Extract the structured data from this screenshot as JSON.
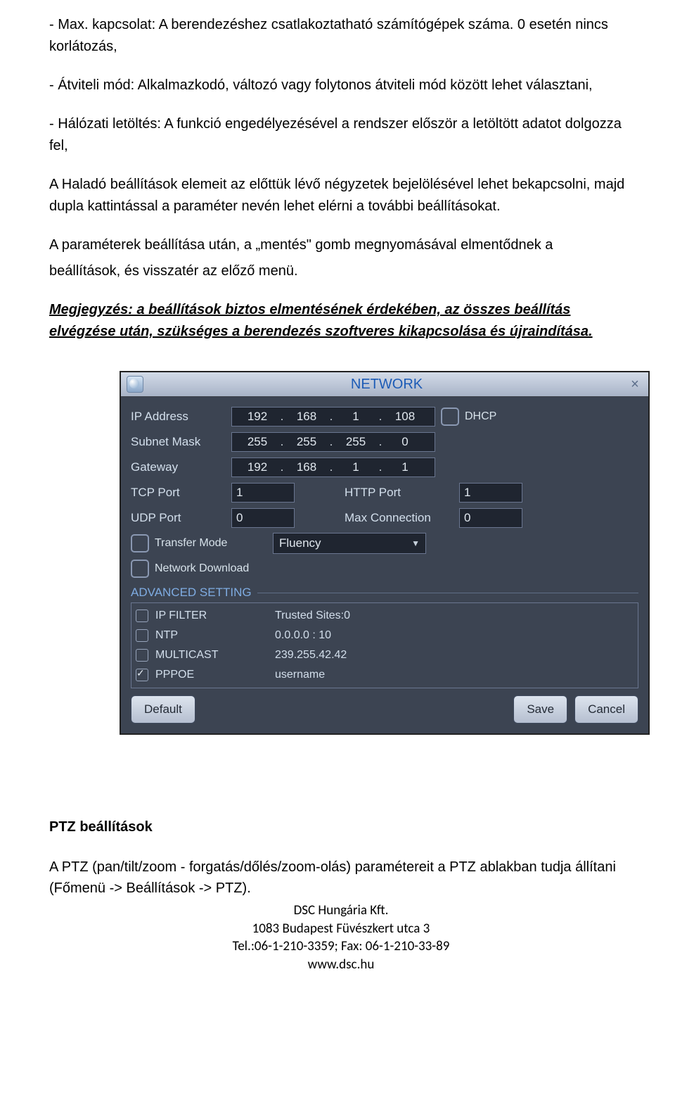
{
  "doc": {
    "p1": "- Max. kapcsolat: A berendezéshez csatlakoztatható számítógépek száma. 0 esetén nincs korlátozás,",
    "p2": "- Átviteli mód: Alkalmazkodó, változó vagy folytonos átviteli mód között lehet választani,",
    "p3": "- Hálózati letöltés: A funkció engedélyezésével a rendszer először a letöltött adatot dolgozza fel,",
    "p4": " A Haladó beállítások elemeit az előttük lévő négyzetek bejelölésével lehet bekapcsolni, majd dupla kattintással a paraméter nevén lehet elérni a további beállításokat.",
    "p5a": "A paraméterek beállítása után, a „mentés\" gomb megnyomásával elmentődnek a",
    "p5b": "beállítások, és visszatér az előző menü.",
    "note": "Megjegyzés: a beállítások biztos elmentésének érdekében, az összes beállítás elvégzése után, szükséges a berendezés szoftveres kikapcsolása és újraindítása.",
    "ptz_head": "PTZ beállítások",
    "ptz_para": "A PTZ (pan/tilt/zoom - forgatás/dőlés/zoom-olás) paramétereit a PTZ ablakban tudja állítani (Főmenü -> Beállítások -> PTZ).",
    "footer1": "DSC Hungária Kft.",
    "footer2": "1083 Budapest Füvészkert utca 3",
    "footer3": "Tel.:06-1-210-3359; Fax: 06-1-210-33-89",
    "footer4": "www.dsc.hu"
  },
  "net": {
    "title": "NETWORK",
    "labels": {
      "ip": "IP Address",
      "subnet": "Subnet Mask",
      "gateway": "Gateway",
      "tcp": "TCP Port",
      "http": "HTTP Port",
      "udp": "UDP Port",
      "max": "Max Connection",
      "dhcp": "DHCP",
      "transfer": "Transfer Mode",
      "netdl": "Network Download",
      "advanced": "ADVANCED SETTING"
    },
    "ip": [
      "192",
      "168",
      "1",
      "108"
    ],
    "subnet": [
      "255",
      "255",
      "255",
      "0"
    ],
    "gateway": [
      "192",
      "168",
      "1",
      "1"
    ],
    "tcp": "1",
    "http": "1",
    "udp": "0",
    "maxconn": "0",
    "transfer_val": "Fluency",
    "adv": [
      {
        "name": "IP FILTER",
        "val": "Trusted Sites:0",
        "checked": false
      },
      {
        "name": "NTP",
        "val": "0.0.0.0 : 10",
        "checked": false
      },
      {
        "name": "MULTICAST",
        "val": "239.255.42.42",
        "checked": false
      },
      {
        "name": "PPPOE",
        "val": "username",
        "checked": true
      }
    ],
    "buttons": {
      "default": "Default",
      "save": "Save",
      "cancel": "Cancel"
    }
  }
}
